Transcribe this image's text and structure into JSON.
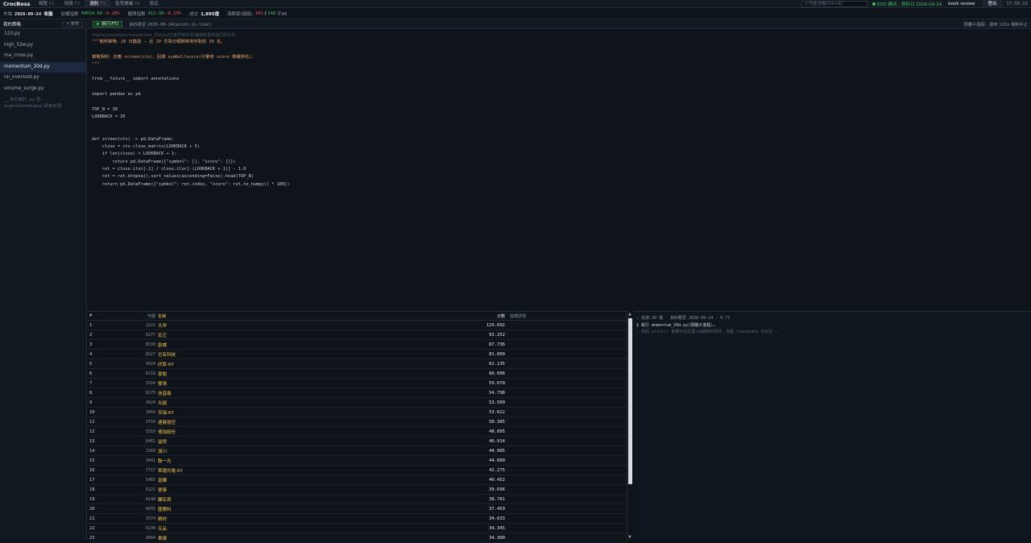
{
  "app": {
    "brand": "CrocBoss",
    "nav": [
      {
        "label": "總覽",
        "key": "F1"
      },
      {
        "label": "持股",
        "key": "F2"
      },
      {
        "label": "選股",
        "key": "F3"
      },
      {
        "label": "智慧建議",
        "key": "F4"
      },
      {
        "label": "設定",
        "key": ""
      }
    ],
    "active_nav": 2,
    "search_placeholder": "2-代號/名稱(Ctrl+K)",
    "mode": "EOD 模式 · 資料日 2026-09-24",
    "review": "book review",
    "logout": "登出",
    "clock": "17:56:13"
  },
  "market": {
    "market_label": "市場",
    "market_value": "2026-09-24 收盤",
    "taiex_label": "加權指數",
    "taiex_value": "40024.60",
    "taiex_change": "-0.28%",
    "otc_label": "櫃買指數",
    "otc_value": "412.99",
    "otc_change": "-0.19%",
    "volume_label": "成交",
    "volume_value": "1,895億",
    "breadth_label": "漲跌家(個股)",
    "breadth_up": "341",
    "breadth_sep": "/",
    "breadth_down": "348",
    "breadth_flat": "平96"
  },
  "sidebar": {
    "title": "我的策略",
    "new_label": "+ 新增",
    "files": [
      "123.py",
      "high_52w.py",
      "ma_cross.py",
      "momentum_20d.py",
      "rsi_oversold.py",
      "volume_surge.py"
    ],
    "active_file": 3,
    "note": "__ 未已寫於 .py 至：\nengine/strategies/ 即會出現"
  },
  "editor": {
    "run_label": "執行(F5)",
    "snapshot_label": "資料截至",
    "snapshot_value": "2026-09-24(point-in-time)",
    "hint": "隔離子進程 · 逾時 120s 強制中止",
    "path": "engine/strategies/momentum_20d.py(已進界單外導)編輯後重新執行即生效",
    "lines": [
      "\"\"\"範例策略：20 日動能 — 近 20 交易日報酬率排序取前 30 名。",
      "",
      "策略契約：定義 screen(ctx)，回傳 symbol/score(引擎依 score 降冪排名)。",
      "\"\"\"",
      "",
      "from __future__ import annotations",
      "",
      "import pandas as pd",
      "",
      "TOP_N = 30",
      "LOOKBACK = 20",
      "",
      "",
      "def screen(ctx) -> pd.DataFrame:",
      "    close = ctx.close_matrix(LOOKBACK + 5)",
      "    if len(close) < LOOKBACK + 1:",
      "        return pd.DataFrame({\"symbol\": [], \"score\": []})",
      "    ret = close.iloc[-1] / close.iloc[-(LOOKBACK + 1)] - 1.0",
      "    ret = ret.dropna().sort_values(ascending=False).head(TOP_N)",
      "    return pd.DataFrame({\"symbol\": ret.index, \"score\": ret.to_numpy() * 100})"
    ]
  },
  "results": {
    "headers": {
      "idx": "#",
      "code": "代號",
      "name": "名稱",
      "score": "分數",
      "note": "指標詳情"
    },
    "rows": [
      {
        "idx": "1",
        "code": "2221",
        "name": "大甲",
        "score": "129.692"
      },
      {
        "idx": "2",
        "code": "6277",
        "name": "宏正",
        "score": "93.252"
      },
      {
        "idx": "3",
        "code": "6530",
        "name": "創威",
        "score": "87.736"
      },
      {
        "idx": "4",
        "code": "8227",
        "name": "巨有科技",
        "score": "81.899"
      },
      {
        "idx": "5",
        "code": "4924",
        "name": "欣厚-KY",
        "score": "62.135"
      },
      {
        "idx": "6",
        "code": "6218",
        "name": "豪勉",
        "score": "60.606"
      },
      {
        "idx": "7",
        "code": "3324",
        "name": "雙鴻",
        "score": "59.070"
      },
      {
        "idx": "8",
        "code": "6173",
        "name": "信昌電",
        "score": "54.798"
      },
      {
        "idx": "9",
        "code": "3624",
        "name": "光頡",
        "score": "53.509"
      },
      {
        "idx": "10",
        "code": "3664",
        "name": "安瑞-KY",
        "score": "53.022"
      },
      {
        "idx": "11",
        "code": "3710",
        "name": "連展投控",
        "score": "50.385"
      },
      {
        "idx": "12",
        "code": "3219",
        "name": "倚強股份",
        "score": "48.895"
      },
      {
        "idx": "13",
        "code": "6461",
        "name": "益得",
        "score": "46.914"
      },
      {
        "idx": "14",
        "code": "1569",
        "name": "濱川",
        "score": "44.905"
      },
      {
        "idx": "15",
        "code": "3441",
        "name": "聯一光",
        "score": "44.000"
      },
      {
        "idx": "16",
        "code": "7717",
        "name": "萊德光電-KY",
        "score": "42.275"
      },
      {
        "idx": "17",
        "code": "5465",
        "name": "富驊",
        "score": "40.452"
      },
      {
        "idx": "18",
        "code": "6221",
        "name": "晉泰",
        "score": "39.696"
      },
      {
        "idx": "19",
        "code": "6148",
        "name": "驊宏資",
        "score": "38.761"
      },
      {
        "idx": "20",
        "code": "8431",
        "name": "匯鑽科",
        "score": "37.459"
      },
      {
        "idx": "21",
        "code": "3374",
        "name": "精材",
        "score": "34.633"
      },
      {
        "idx": "22",
        "code": "6199",
        "name": "天品",
        "score": "34.345"
      },
      {
        "idx": "23",
        "code": "8064",
        "name": "東捷",
        "score": "34.300"
      }
    ]
  },
  "console": {
    "lines": [
      {
        "kind": "ok",
        "text": "✓ 完成:30 檔 · 資料截至 2026-09-24 · 0.71"
      },
      {
        "kind": "cmd",
        "text": "$ 執行 momentum_20d.py(隔離子進程)…"
      },
      {
        "kind": "tip",
        "text": "— 你的 print() 會顯示在這裡;出錯時的例外、完整 traceback 也在這 —"
      }
    ]
  },
  "colors": {
    "accent_up": "#3fbf6a",
    "accent_down": "#e05a5a",
    "stock_name": "#f2c14e",
    "docstring": "#e3a16b",
    "active_file_bg": "#1d2a3d"
  }
}
